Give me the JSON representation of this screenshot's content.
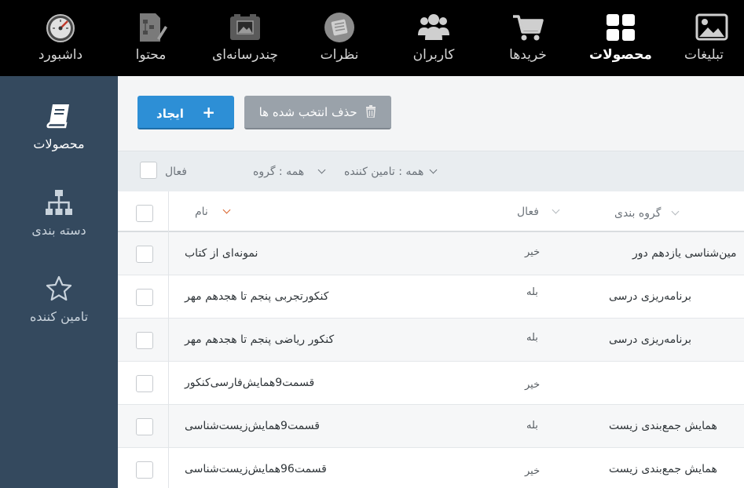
{
  "topnav": {
    "items": [
      {
        "label": "تبلیغات",
        "icon": "image-icon"
      },
      {
        "label": "محصولات",
        "icon": "grid-icon"
      },
      {
        "label": "خریدها",
        "icon": "cart-icon"
      },
      {
        "label": "کاربران",
        "icon": "users-icon"
      },
      {
        "label": "نظرات",
        "icon": "comment-icon"
      },
      {
        "label": "چندرسانه‌ای",
        "icon": "media-icon"
      },
      {
        "label": "محتوا",
        "icon": "content-icon"
      },
      {
        "label": "داشبورد",
        "icon": "gauge-icon"
      }
    ],
    "active_label": "محصولات"
  },
  "sidebar": {
    "items": [
      {
        "label": "محصولات",
        "icon": "book-icon"
      },
      {
        "label": "دسته بندی",
        "icon": "sitemap-icon"
      },
      {
        "label": "تامین کننده",
        "icon": "star-icon"
      }
    ]
  },
  "toolbar": {
    "create_label": "ایجاد",
    "create_icon": "+",
    "delete_label": "حذف انتخب شده ها"
  },
  "filters": {
    "active_label": "فعال",
    "group_label": "همه : گروه",
    "supplier_label": "همه : تامین کننده"
  },
  "table": {
    "columns": {
      "category": "گروه بندی",
      "active": "فعال",
      "name": "نام"
    },
    "rows": [
      {
        "category": "مین‌شناسی یازدهم دور",
        "active": "خیر",
        "name": "نمونه‌ای از کتاب"
      },
      {
        "category": "برنامه‌ریزی درسی",
        "active": "بله",
        "name": "کنکورتجربی پنجم تا هجدهم مهر"
      },
      {
        "category": "برنامه‌ریزی درسی",
        "active": "بله",
        "name": "کنکور ریاضی پنجم تا هجدهم مهر"
      },
      {
        "category": "",
        "active": "خیر",
        "name": "قسمت9همایش‌فارسی‌کنکور"
      },
      {
        "category": "همایش جمع‌بندی زیست",
        "active": "بله",
        "name": "قسمت9همایش‌زیست‌شناسی"
      },
      {
        "category": "همایش جمع‌بندی زیست",
        "active": "خیر",
        "name": "قسمت96همایش‌زیست‌شناسی"
      }
    ]
  },
  "colors": {
    "topbar": "#000000",
    "sidebar": "#34495e",
    "primary_button": "#2d8fd6",
    "disabled_button": "#9aa2aa",
    "sort_arrow": "#d9622b"
  }
}
